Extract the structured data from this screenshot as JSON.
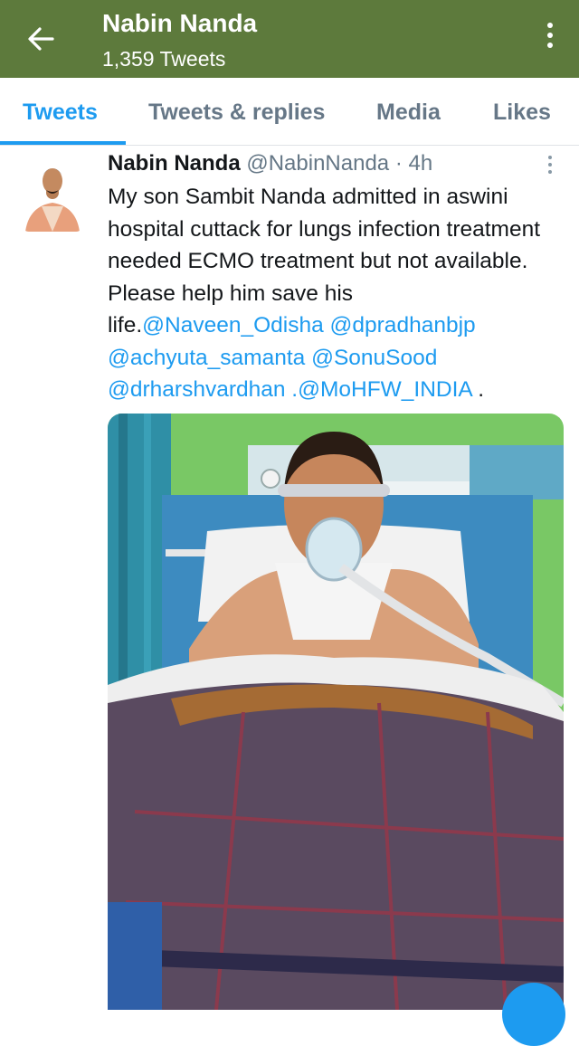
{
  "header": {
    "title": "Nabin Nanda",
    "subtitle": "1,359 Tweets"
  },
  "tabs": [
    {
      "label": "Tweets",
      "active": true
    },
    {
      "label": "Tweets & replies",
      "active": false
    },
    {
      "label": "Media",
      "active": false
    },
    {
      "label": "Likes",
      "active": false
    }
  ],
  "tweet": {
    "author_name": "Nabin Nanda",
    "author_handle": "@NabinNanda",
    "time": " · 4h",
    "text_main": "My son Sambit Nanda admitted in aswini hospital cuttack for lungs infection treatment needed ECMO treatment but not available. Please help him save his life.",
    "mentions": {
      "m1": "@Naveen_Odisha",
      "m2": "@dpradhanbjp",
      "m3": "@achyuta_samanta",
      "m4": "@SonuSood",
      "m5": "@drharshvardhan",
      "m6": ".@MoHFW_INDIA"
    },
    "text_end": " ."
  },
  "colors": {
    "header_bg": "#5d7a3c",
    "accent": "#1d9bf0"
  },
  "icons": {
    "back": "arrow-left-icon",
    "overflow": "more-vertical-icon",
    "compose": "compose-fab"
  }
}
